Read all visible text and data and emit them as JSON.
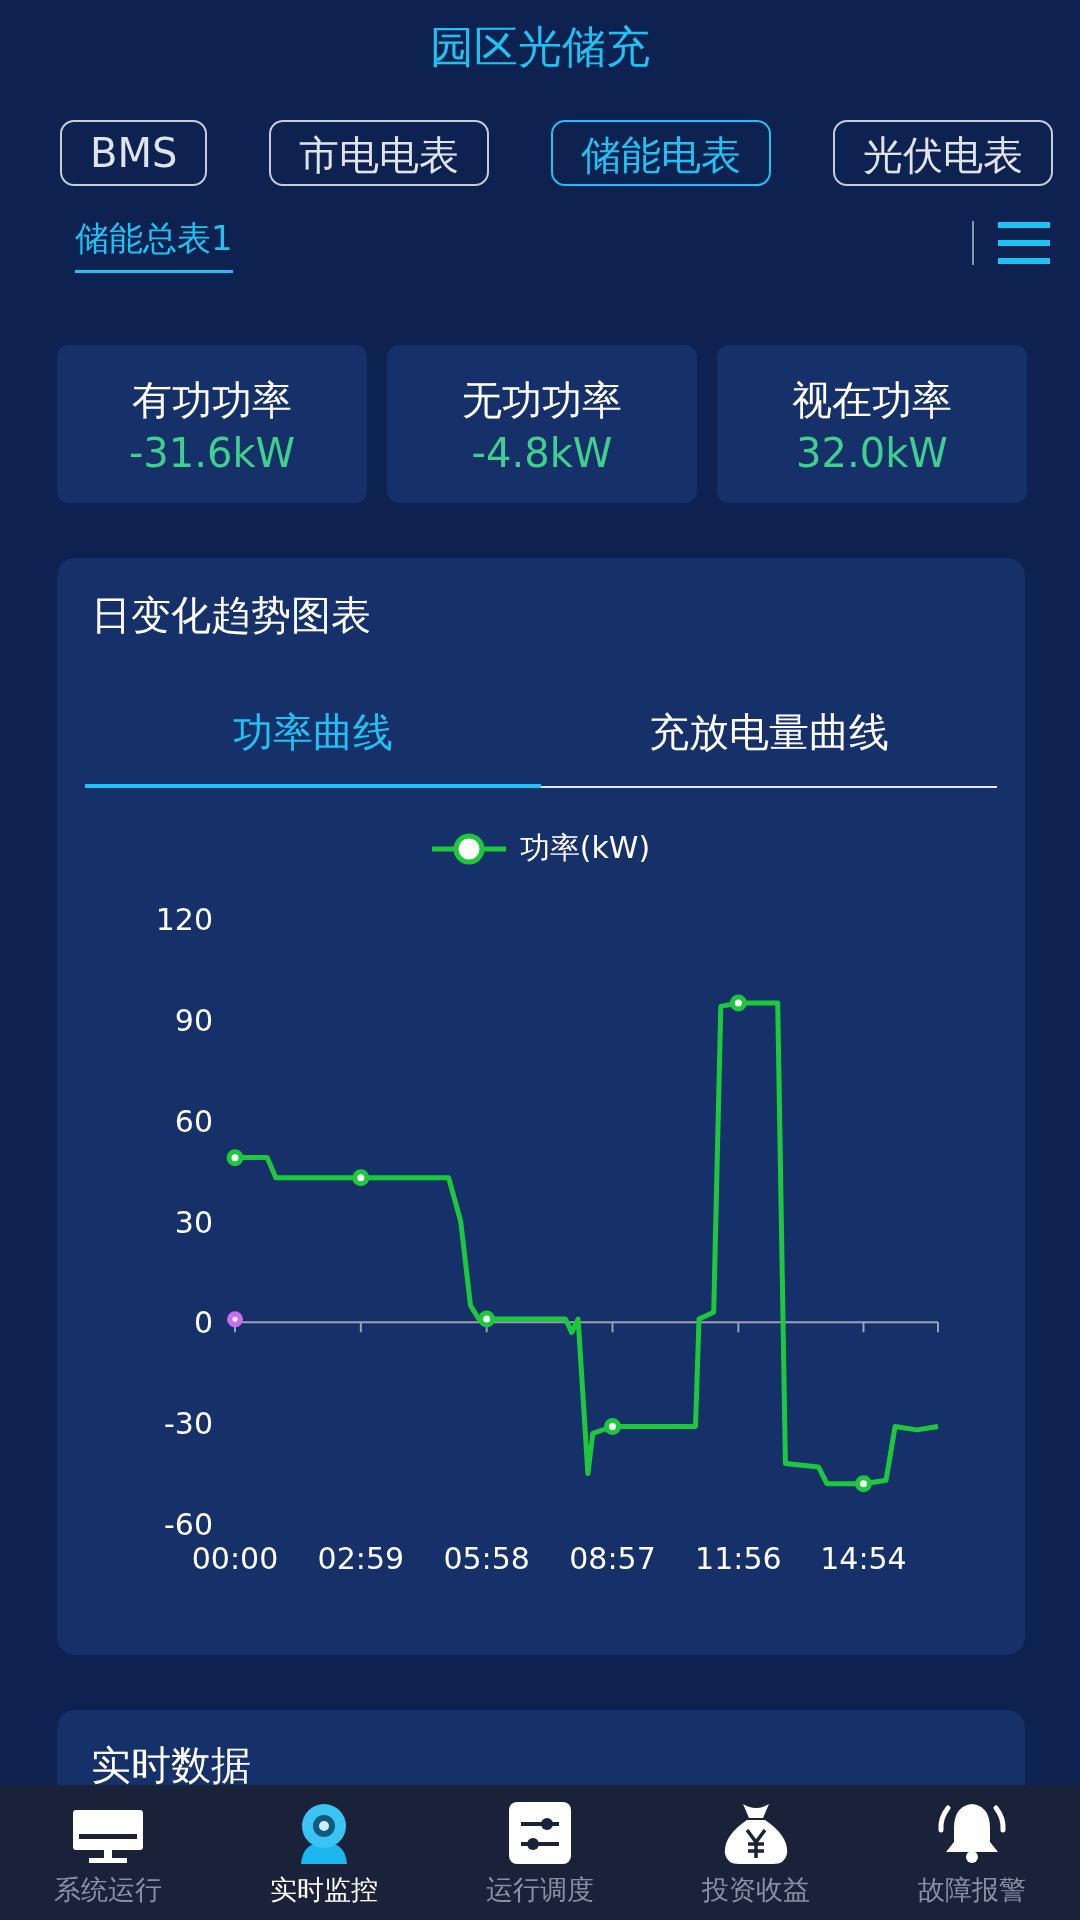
{
  "title": "园区光储充",
  "tabs": [
    {
      "label": "BMS",
      "selected": false
    },
    {
      "label": "市电电表",
      "selected": false
    },
    {
      "label": "储能电表",
      "selected": true
    },
    {
      "label": "光伏电表",
      "selected": false
    }
  ],
  "sub_tabs": [
    {
      "label": "储能总表1",
      "selected": true
    }
  ],
  "stats": [
    {
      "label": "有功功率",
      "value": "-31.6kW"
    },
    {
      "label": "无功功率",
      "value": "-4.8kW"
    },
    {
      "label": "视在功率",
      "value": "32.0kW"
    }
  ],
  "trend_card": {
    "title": "日变化趋势图表",
    "tabs": [
      {
        "label": "功率曲线",
        "selected": true
      },
      {
        "label": "充放电量曲线",
        "selected": false
      }
    ],
    "chart_data": {
      "type": "line",
      "x": [
        0,
        46,
        58,
        179,
        304,
        321,
        335,
        347,
        358,
        470,
        479,
        488,
        502,
        509,
        537,
        593,
        655,
        660,
        681,
        691,
        716,
        772,
        783,
        830,
        842,
        891,
        894,
        926,
        939,
        970,
        1000
      ],
      "series": [
        {
          "name": "功率(kW)",
          "color": "#1ec83c",
          "values": [
            49,
            49,
            43,
            43,
            43,
            30,
            5,
            1,
            1,
            1,
            -3,
            1,
            -45,
            -33,
            -31,
            -31,
            -31,
            1,
            3,
            94,
            95,
            95,
            -42,
            -43,
            -48,
            -48,
            -48,
            -47,
            -31,
            -32,
            -31
          ]
        }
      ],
      "xlim": [
        0,
        1000
      ],
      "ylim": [
        -60,
        120
      ],
      "xticks": [
        {
          "value": 0,
          "label": "00:00"
        },
        {
          "value": 179,
          "label": "02:59"
        },
        {
          "value": 358,
          "label": "05:58"
        },
        {
          "value": 537,
          "label": "08:57"
        },
        {
          "value": 716,
          "label": "11:56"
        },
        {
          "value": 894,
          "label": "14:54"
        }
      ],
      "yticks": [
        -60,
        -30,
        0,
        30,
        60,
        90,
        120
      ]
    }
  },
  "realtime_card": {
    "title": "实时数据"
  },
  "nav": [
    {
      "label": "系统运行",
      "selected": false
    },
    {
      "label": "实时监控",
      "selected": true
    },
    {
      "label": "运行调度",
      "selected": false
    },
    {
      "label": "投资收益",
      "selected": false
    },
    {
      "label": "故障报警",
      "selected": false
    }
  ]
}
